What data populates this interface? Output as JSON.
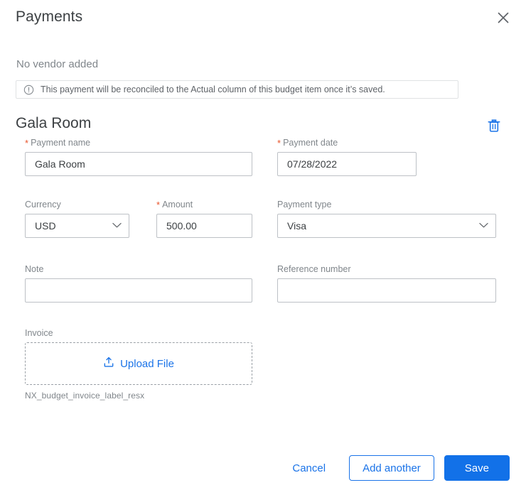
{
  "dialog": {
    "title": "Payments",
    "close_icon": "close-icon"
  },
  "vendor": {
    "status_text": "No vendor added"
  },
  "info_banner": {
    "icon": "info-circle-icon",
    "text": "This payment will be reconciled to the Actual column of this budget item once it’s saved."
  },
  "section": {
    "title": "Gala Room",
    "delete_icon": "trash-icon"
  },
  "form": {
    "payment_name": {
      "label": "Payment name",
      "required": true,
      "value": "Gala Room",
      "placeholder": ""
    },
    "payment_date": {
      "label": "Payment date",
      "required": true,
      "value": "07/28/2022",
      "placeholder": ""
    },
    "currency": {
      "label": "Currency",
      "required": false,
      "value": "USD",
      "chevron_icon": "chevron-down-icon"
    },
    "amount": {
      "label": "Amount",
      "required": true,
      "value": "500.00",
      "placeholder": ""
    },
    "payment_type": {
      "label": "Payment type",
      "required": false,
      "value": "Visa",
      "chevron_icon": "chevron-down-icon"
    },
    "note": {
      "label": "Note",
      "required": false,
      "value": "",
      "placeholder": ""
    },
    "reference_number": {
      "label": "Reference number",
      "required": false,
      "value": "",
      "placeholder": ""
    },
    "invoice": {
      "label": "Invoice",
      "upload_label": "Upload File",
      "upload_icon": "upload-icon",
      "filename_text": "NX_budget_invoice_label_resx"
    }
  },
  "footer": {
    "cancel_label": "Cancel",
    "add_another_label": "Add another",
    "save_label": "Save"
  },
  "colors": {
    "accent_blue": "#1a73e8",
    "primary_button": "#1271e8",
    "required_star": "#e8542b",
    "text_primary": "#3c4043",
    "text_secondary": "#80868b",
    "border": "#bdc1c6"
  }
}
